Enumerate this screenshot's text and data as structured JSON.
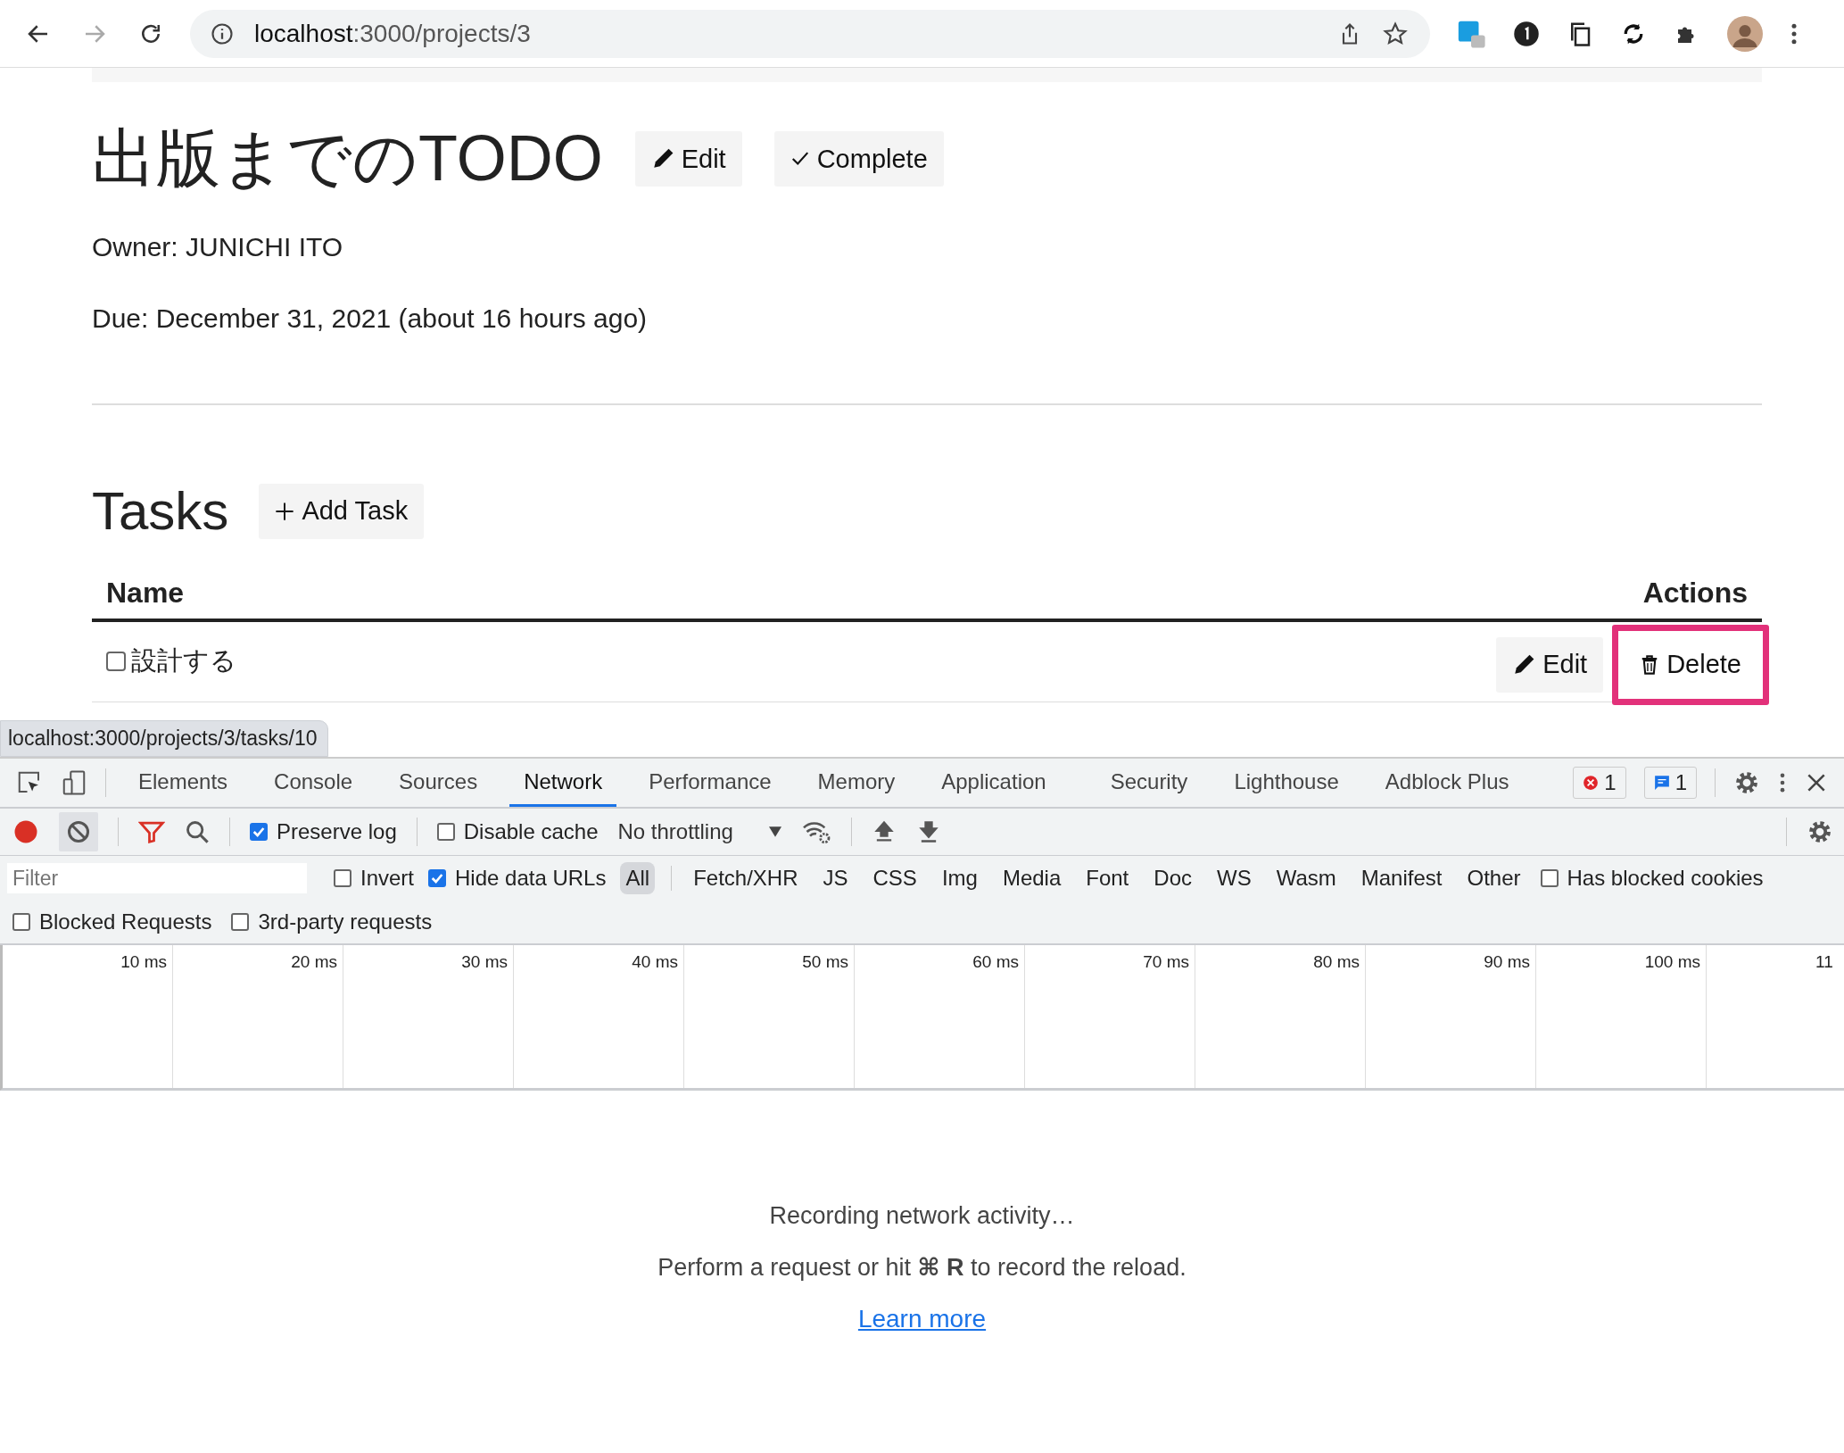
{
  "browser": {
    "url_host": "localhost",
    "url_rest": ":3000/projects/3"
  },
  "page": {
    "title": "出版までのTODO",
    "title_buttons": [
      {
        "kind": "pencil",
        "label": "Edit"
      },
      {
        "kind": "check",
        "label": "Complete"
      }
    ],
    "owner": "Owner: JUNICHI ITO",
    "due": "Due: December 31, 2021 (about 16 hours ago)",
    "tasks_heading": "Tasks",
    "add_task": {
      "kind": "plus",
      "label": "Add Task"
    },
    "table": {
      "columns": [
        "Name",
        "Actions"
      ],
      "rows": [
        {
          "done": false,
          "name": "設計する",
          "actions": [
            {
              "kind": "pencil",
              "label": "Edit",
              "highlighted": false
            },
            {
              "kind": "trash",
              "label": "Delete",
              "highlighted": true
            }
          ]
        }
      ]
    }
  },
  "link_preview": "localhost:3000/projects/3/tasks/10",
  "devtools": {
    "tabs": [
      {
        "label": "Elements",
        "selected": false
      },
      {
        "label": "Console",
        "selected": false
      },
      {
        "label": "Sources",
        "selected": false
      },
      {
        "label": "Network",
        "selected": true
      },
      {
        "label": "Performance",
        "selected": false
      },
      {
        "label": "Memory",
        "selected": false
      },
      {
        "label": "Application",
        "selected": false
      },
      {
        "label": "Security",
        "selected": false
      },
      {
        "label": "Lighthouse",
        "selected": false
      },
      {
        "label": "Adblock Plus",
        "selected": false
      }
    ],
    "error_count": "1",
    "message_count": "1",
    "recording": true,
    "preserve_log": {
      "label": "Preserve log",
      "checked": true
    },
    "disable_cache": {
      "label": "Disable cache",
      "checked": false
    },
    "throttling": "No throttling",
    "filter": {
      "placeholder": "Filter"
    },
    "invert": {
      "label": "Invert",
      "checked": false
    },
    "hide_data_urls": {
      "label": "Hide data URLs",
      "checked": true
    },
    "types": [
      {
        "label": "All",
        "selected": true
      },
      {
        "label": "Fetch/XHR",
        "selected": false
      },
      {
        "label": "JS",
        "selected": false
      },
      {
        "label": "CSS",
        "selected": false
      },
      {
        "label": "Img",
        "selected": false
      },
      {
        "label": "Media",
        "selected": false
      },
      {
        "label": "Font",
        "selected": false
      },
      {
        "label": "Doc",
        "selected": false
      },
      {
        "label": "WS",
        "selected": false
      },
      {
        "label": "Wasm",
        "selected": false
      },
      {
        "label": "Manifest",
        "selected": false
      },
      {
        "label": "Other",
        "selected": false
      }
    ],
    "has_blocked_cookies": {
      "label": "Has blocked cookies",
      "checked": false
    },
    "blocked_requests": {
      "label": "Blocked Requests",
      "checked": false
    },
    "third_party": {
      "label": "3rd-party requests",
      "checked": false
    },
    "timeline_ticks": [
      "10 ms",
      "20 ms",
      "30 ms",
      "40 ms",
      "50 ms",
      "60 ms",
      "70 ms",
      "80 ms",
      "90 ms",
      "100 ms",
      "11"
    ],
    "empty_title": "Recording network activity…",
    "empty_hint": "Perform a request or hit **⌘ R** to record the reload.",
    "learn_more": "Learn more"
  }
}
